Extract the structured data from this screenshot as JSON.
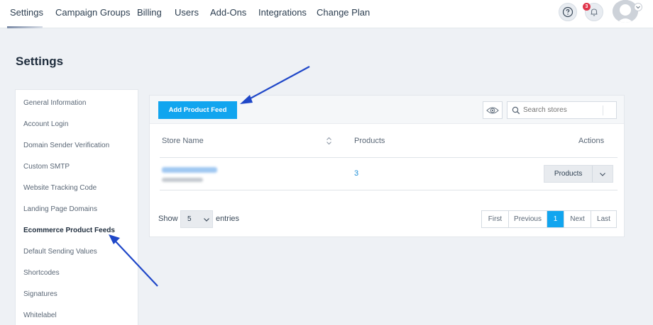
{
  "nav": {
    "items": [
      "Settings",
      "Campaign Groups",
      "Billing",
      "Users",
      "Add-Ons",
      "Integrations",
      "Change Plan"
    ],
    "notification_count": "3"
  },
  "page": {
    "title": "Settings"
  },
  "sidebar": {
    "items": [
      "General Information",
      "Account Login",
      "Domain Sender Verification",
      "Custom SMTP",
      "Website Tracking Code",
      "Landing Page Domains",
      "Ecommerce Product Feeds",
      "Default Sending Values",
      "Shortcodes",
      "Signatures",
      "Whitelabel"
    ],
    "active_index": 6
  },
  "toolbar": {
    "add_label": "Add Product Feed",
    "search_placeholder": "Search stores"
  },
  "table": {
    "headers": [
      "Store Name",
      "Products",
      "Actions"
    ],
    "rows": [
      {
        "products": "3",
        "action_label": "Products"
      }
    ]
  },
  "footer": {
    "show_label": "Show",
    "entries_value": "5",
    "entries_label": "entries",
    "pagination": [
      "First",
      "Previous",
      "1",
      "Next",
      "Last"
    ],
    "current_page": "1"
  },
  "colors": {
    "accent": "#11a5ef",
    "arrow": "#1f47c8",
    "badge": "#e0364b",
    "link": "#1d8fd8"
  }
}
